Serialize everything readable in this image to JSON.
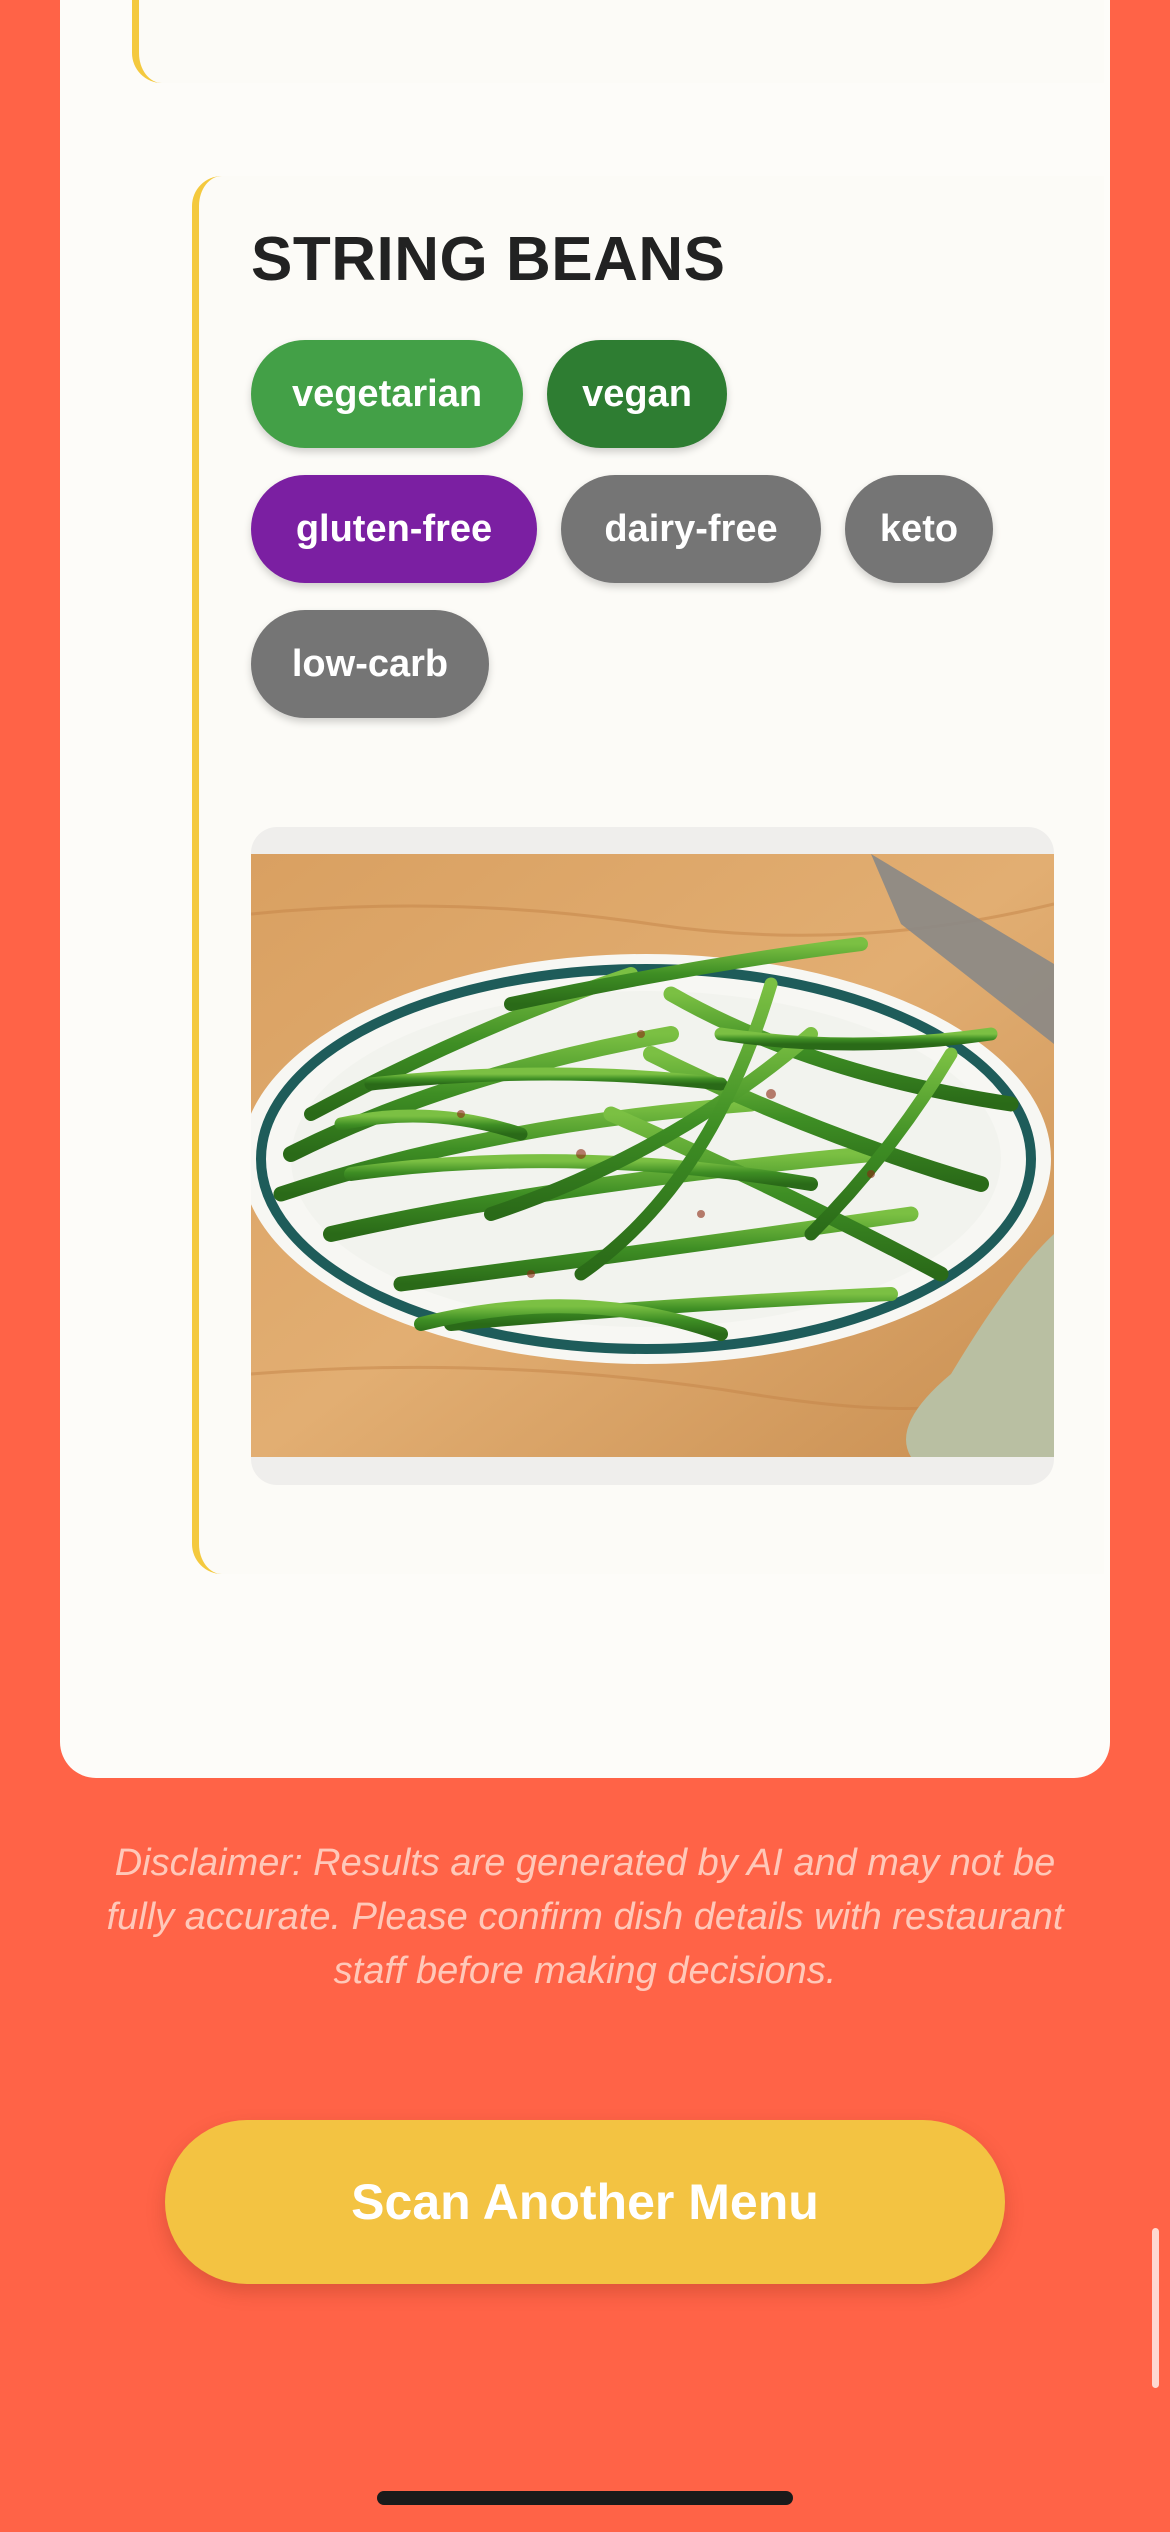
{
  "dish": {
    "title": "STRING BEANS",
    "tags": [
      {
        "label": "vegetarian",
        "color": "#43A047"
      },
      {
        "label": "vegan",
        "color": "#2E7D32"
      },
      {
        "label": "gluten-free",
        "color": "#7B1FA2"
      },
      {
        "label": "dairy-free",
        "color": "#757575"
      },
      {
        "label": "keto",
        "color": "#757575"
      },
      {
        "label": "low-carb",
        "color": "#757575"
      }
    ]
  },
  "disclaimer": "Disclaimer: Results are generated by AI and may not be fully accurate. Please confirm dish details with restaurant staff before making decisions.",
  "scan_button_label": "Scan Another Menu",
  "colors": {
    "background": "#FF6347",
    "card_accent": "#F4C93E",
    "button": "#F3C342"
  }
}
